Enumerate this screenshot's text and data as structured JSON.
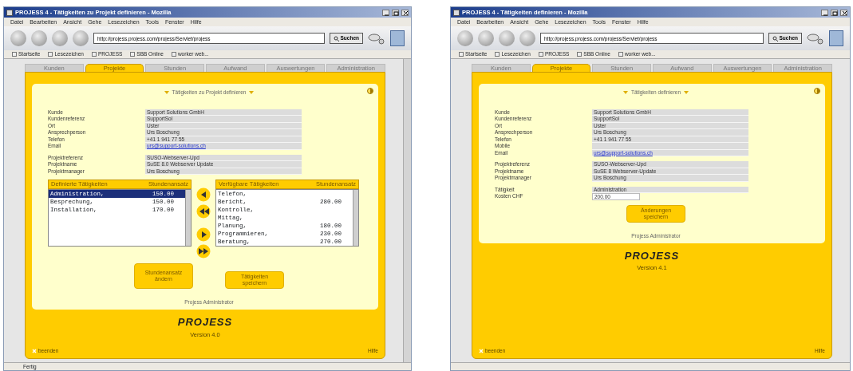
{
  "windows": [
    {
      "title": "PROJESS 4 - Tätigkeiten zu Projekt definieren - Mozilla",
      "menu": [
        "Datei",
        "Bearbeiten",
        "Ansicht",
        "Gehe",
        "Lesezeichen",
        "Tools",
        "Fenster",
        "Hilfe"
      ],
      "url": "http://projess.projess.com/projess/Servlet/projess",
      "search_button": "Suchen",
      "bookmarks": [
        "Startseite",
        "Lesezeichen",
        "PROJESS",
        "SBB Online",
        "worker web..."
      ],
      "tabs": [
        {
          "label": "Kunden",
          "selected": false
        },
        {
          "label": "Projekte",
          "selected": true
        },
        {
          "label": "Stunden",
          "selected": false
        },
        {
          "label": "Aufwand",
          "selected": false
        },
        {
          "label": "Auswertungen",
          "selected": false
        },
        {
          "label": "Administration",
          "selected": false
        }
      ],
      "panel_title": "Tätigkeiten zu Projekt definieren",
      "sections": [
        {
          "kind": "fields",
          "rows": [
            {
              "label": "Kunde",
              "value": "Support Solutions GmbH",
              "kind": "text"
            },
            {
              "label": "Kundenreferenz",
              "value": "SupportSol",
              "kind": "text"
            },
            {
              "label": "Ort",
              "value": "Uster",
              "kind": "text"
            },
            {
              "label": "Ansprechperson",
              "value": "Urs Boschung",
              "kind": "text"
            },
            {
              "label": "Telefon",
              "value": "+41 1 941 77 55",
              "kind": "text"
            },
            {
              "label": "Email",
              "value": "urs@support-solutions.ch",
              "kind": "link"
            }
          ]
        },
        {
          "kind": "fields",
          "rows": [
            {
              "label": "Projektreferenz",
              "value": "SUSO-Webserver-Upd",
              "kind": "text"
            },
            {
              "label": "Projektname",
              "value": "SuSE 8.0 Webserver Update",
              "kind": "text"
            },
            {
              "label": "Projektmanager",
              "value": "Urs Boschung",
              "kind": "text"
            }
          ]
        },
        {
          "kind": "transfer",
          "lists": [
            {
              "headers": [
                "Definierte Tätigkeiten",
                "Stundenansatz"
              ],
              "items": [
                {
                  "name": "Administration,",
                  "rate": "150.00",
                  "selected": true
                },
                {
                  "name": "Besprechung,",
                  "rate": "150.00",
                  "selected": false
                },
                {
                  "name": "Installation,",
                  "rate": "170.00",
                  "selected": false
                }
              ]
            },
            {
              "headers": [
                "Verfügbare Tätigkeiten",
                "Stundenansatz"
              ],
              "items": [
                {
                  "name": "Telefon,",
                  "selected": false
                },
                {
                  "name": "Bericht,",
                  "rate": "280.00",
                  "selected": false
                },
                {
                  "name": "Kontrolle,",
                  "selected": false
                },
                {
                  "name": "Mittag,",
                  "selected": false
                },
                {
                  "name": "Planung,",
                  "rate": "180.00",
                  "selected": false
                },
                {
                  "name": "Programmieren,",
                  "rate": "230.00",
                  "selected": false
                },
                {
                  "name": "Beratung,",
                  "rate": "270.00",
                  "selected": false
                }
              ]
            }
          ]
        },
        {
          "kind": "buttons",
          "buttons": [
            "Stundenansatz ändern",
            "Tätigkeiten speichern"
          ]
        }
      ],
      "footer_user": "Projess Administrator",
      "logo": "PROJESS",
      "version": "Version 4.0",
      "exit_link": "beenden",
      "help_link": "Hilfe",
      "status_text": "Fertig",
      "scrollbar": true
    },
    {
      "title": "PROJESS 4 - Tätigkeiten definieren - Mozilla",
      "menu": [
        "Datei",
        "Bearbeiten",
        "Ansicht",
        "Gehe",
        "Lesezeichen",
        "Tools",
        "Fenster",
        "Hilfe"
      ],
      "url": "http://projess.projess.com/projess/Servlet/projess",
      "search_button": "Suchen",
      "bookmarks": [
        "Startseite",
        "Lesezeichen",
        "PROJESS",
        "SBB Online",
        "worker web..."
      ],
      "tabs": [
        {
          "label": "Kunden",
          "selected": false
        },
        {
          "label": "Projekte",
          "selected": true
        },
        {
          "label": "Stunden",
          "selected": false
        },
        {
          "label": "Aufwand",
          "selected": false
        },
        {
          "label": "Auswertungen",
          "selected": false
        },
        {
          "label": "Administration",
          "selected": false
        }
      ],
      "panel_title": "Tätigkeiten definieren",
      "sections": [
        {
          "kind": "fields",
          "rows": [
            {
              "label": "Kunde",
              "value": "Support Solutions GmbH",
              "kind": "text"
            },
            {
              "label": "Kundenreferenz",
              "value": "SupportSol",
              "kind": "text"
            },
            {
              "label": "Ort",
              "value": "Uster",
              "kind": "text"
            },
            {
              "label": "Ansprechperson",
              "value": "Urs Boschung",
              "kind": "text"
            },
            {
              "label": "Telefon",
              "value": "+41 1 941 77 55",
              "kind": "text"
            },
            {
              "label": "Mobile",
              "kind": "text"
            },
            {
              "label": "Email",
              "value": "urs@support-solutions.ch",
              "kind": "link"
            }
          ]
        },
        {
          "kind": "fields",
          "rows": [
            {
              "label": "Projektreferenz",
              "value": "SUSO-Webserver-Upd",
              "kind": "text"
            },
            {
              "label": "Projektname",
              "value": "SuSE 8 Webserver-Update",
              "kind": "text"
            },
            {
              "label": "Projektmanager",
              "value": "Urs Boschung",
              "kind": "text"
            }
          ]
        },
        {
          "kind": "fields",
          "rows": [
            {
              "label": "Tätigkeit",
              "value": "Administration",
              "kind": "text"
            },
            {
              "label": "Kosten CHF",
              "value": "200.00",
              "kind": "input"
            }
          ]
        },
        {
          "kind": "buttons",
          "buttons": [
            "Änderungen speichern"
          ]
        }
      ],
      "footer_user": "Projess Administrator",
      "logo": "PROJESS",
      "version": "Version 4.1",
      "exit_link": "beenden",
      "help_link": "Hilfe",
      "scrollbar": false
    }
  ]
}
